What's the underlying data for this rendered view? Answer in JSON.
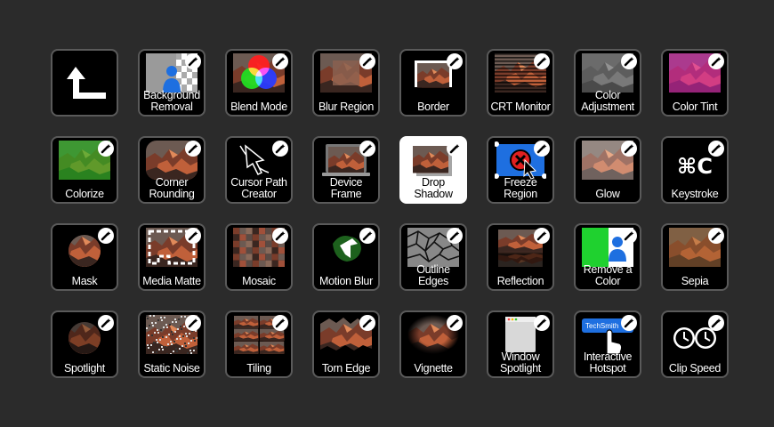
{
  "tiles": [
    {
      "id": "back",
      "label": "",
      "icon": "back-arrow-icon",
      "type": "back"
    },
    {
      "id": "background-removal",
      "label": "Background Removal",
      "icon": "background-removal-icon",
      "type": "bgremoval"
    },
    {
      "id": "blend-mode",
      "label": "Blend Mode",
      "icon": "blend-mode-icon",
      "type": "blend"
    },
    {
      "id": "blur-region",
      "label": "Blur Region",
      "icon": "blur-region-icon",
      "type": "blur"
    },
    {
      "id": "border",
      "label": "Border",
      "icon": "border-icon",
      "type": "border"
    },
    {
      "id": "crt-monitor",
      "label": "CRT Monitor",
      "icon": "crt-monitor-icon",
      "type": "crt"
    },
    {
      "id": "color-adjustment",
      "label": "Color Adjustment",
      "icon": "color-adjustment-icon",
      "type": "gray"
    },
    {
      "id": "color-tint",
      "label": "Color Tint",
      "icon": "color-tint-icon",
      "type": "tint"
    },
    {
      "id": "colorize",
      "label": "Colorize",
      "icon": "colorize-icon",
      "type": "colorize"
    },
    {
      "id": "corner-rounding",
      "label": "Corner Rounding",
      "icon": "corner-rounding-icon",
      "type": "rounded"
    },
    {
      "id": "cursor-path-creator",
      "label": "Cursor Path Creator",
      "icon": "cursor-path-icon",
      "type": "cursorpath"
    },
    {
      "id": "device-frame",
      "label": "Device Frame",
      "icon": "device-frame-icon",
      "type": "device"
    },
    {
      "id": "drop-shadow",
      "label": "Drop Shadow",
      "icon": "drop-shadow-icon",
      "type": "shadow",
      "selected": true
    },
    {
      "id": "freeze-region",
      "label": "Freeze Region",
      "icon": "freeze-region-icon",
      "type": "freeze"
    },
    {
      "id": "glow",
      "label": "Glow",
      "icon": "glow-icon",
      "type": "glow"
    },
    {
      "id": "keystroke",
      "label": "Keystroke",
      "icon": "keystroke-icon",
      "type": "keystroke",
      "glyph": "⌘C"
    },
    {
      "id": "mask",
      "label": "Mask",
      "icon": "mask-icon",
      "type": "mask"
    },
    {
      "id": "media-matte",
      "label": "Media Matte",
      "icon": "media-matte-icon",
      "type": "matte"
    },
    {
      "id": "mosaic",
      "label": "Mosaic",
      "icon": "mosaic-icon",
      "type": "mosaic"
    },
    {
      "id": "motion-blur",
      "label": "Motion Blur",
      "icon": "motion-blur-icon",
      "type": "motion"
    },
    {
      "id": "outline-edges",
      "label": "Outline Edges",
      "icon": "outline-edges-icon",
      "type": "outline"
    },
    {
      "id": "reflection",
      "label": "Reflection",
      "icon": "reflection-icon",
      "type": "reflection"
    },
    {
      "id": "remove-a-color",
      "label": "Remove a Color",
      "icon": "remove-color-icon",
      "type": "removecolor"
    },
    {
      "id": "sepia",
      "label": "Sepia",
      "icon": "sepia-icon",
      "type": "sepia"
    },
    {
      "id": "spotlight",
      "label": "Spotlight",
      "icon": "spotlight-icon",
      "type": "spotlight"
    },
    {
      "id": "static-noise",
      "label": "Static Noise",
      "icon": "static-noise-icon",
      "type": "noise"
    },
    {
      "id": "tiling",
      "label": "Tiling",
      "icon": "tiling-icon",
      "type": "tiling"
    },
    {
      "id": "torn-edge",
      "label": "Torn Edge",
      "icon": "torn-edge-icon",
      "type": "torn"
    },
    {
      "id": "vignette",
      "label": "Vignette",
      "icon": "vignette-icon",
      "type": "vignette"
    },
    {
      "id": "window-spotlight",
      "label": "Window Spotlight",
      "icon": "window-spotlight-icon",
      "type": "window"
    },
    {
      "id": "interactive-hotspot",
      "label": "Interactive Hotspot",
      "icon": "interactive-hotspot-icon",
      "type": "hotspot",
      "badge": "TechSmith"
    },
    {
      "id": "clip-speed",
      "label": "Clip Speed",
      "icon": "clip-speed-icon",
      "type": "clipspeed"
    }
  ],
  "colors": {
    "background": "#2b2b2b",
    "tile_border": "#5a5a5a",
    "selected_bg": "#ffffff",
    "accent_blue": "#1e6fe0",
    "remove_green": "#1fd12f"
  }
}
